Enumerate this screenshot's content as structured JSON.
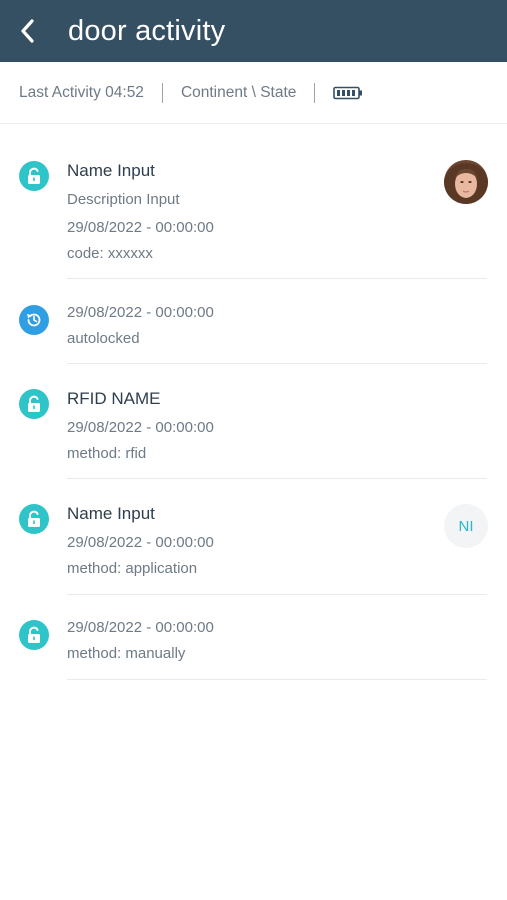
{
  "header": {
    "title": "door activity",
    "back_icon": "chevron-left-icon"
  },
  "status": {
    "last_activity": "Last Activity 04:52",
    "location": "Continent \\ State",
    "battery_icon": "battery-full-icon"
  },
  "colors": {
    "header_bg": "#354f63",
    "unlock_icon": "#2ec4c8",
    "history_icon": "#2f9ee3"
  },
  "activities": [
    {
      "icon": "unlock-icon",
      "name": "Name Input",
      "description": "Description Input",
      "datetime": "29/08/2022 - 00:00:00",
      "detail": "code: xxxxxx",
      "avatar": "photo"
    },
    {
      "icon": "history-icon",
      "datetime": "29/08/2022 - 00:00:00",
      "detail": "autolocked"
    },
    {
      "icon": "unlock-icon",
      "name": "RFID NAME",
      "datetime": "29/08/2022 - 00:00:00",
      "detail": "method: rfid"
    },
    {
      "icon": "unlock-icon",
      "name": "Name Input",
      "datetime": "29/08/2022 - 00:00:00",
      "detail": "method: application",
      "avatar_initials": "NI"
    },
    {
      "icon": "unlock-icon",
      "datetime": "29/08/2022 - 00:00:00",
      "detail": "method: manually"
    }
  ]
}
